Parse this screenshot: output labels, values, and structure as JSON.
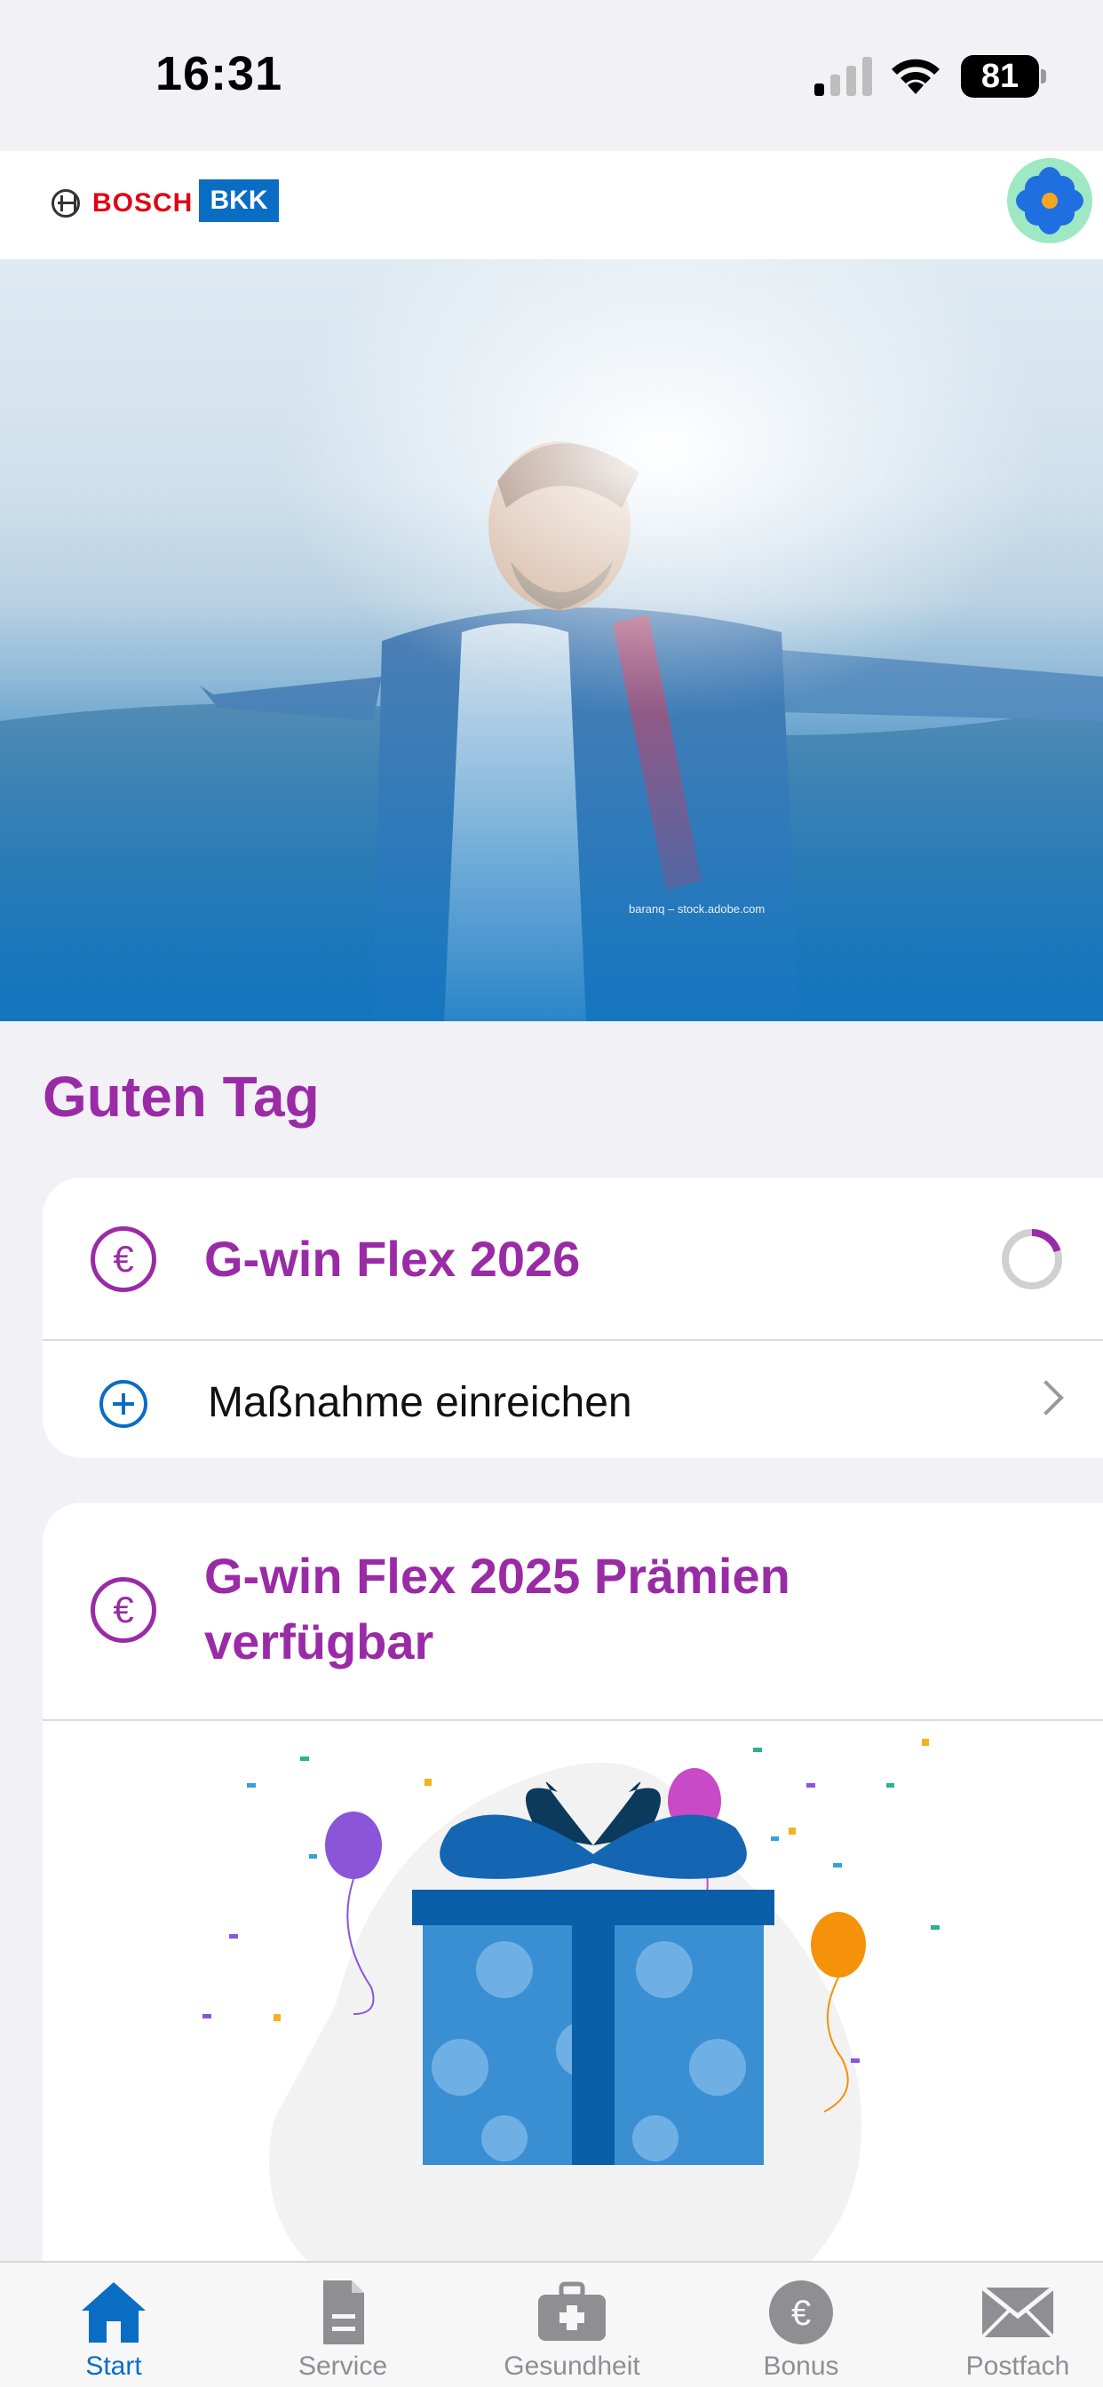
{
  "status_bar": {
    "time": "16:31",
    "battery_level": "81",
    "icons": [
      "signal-icon",
      "wifi-icon",
      "battery-icon"
    ]
  },
  "header": {
    "logo_text": "BOSCH",
    "badge_text": "BKK",
    "avatar_icon": "flower-avatar-icon"
  },
  "hero": {
    "image": "man-with-open-arms-photo",
    "credit": "baranq – stock.adobe.com"
  },
  "greeting": "Guten Tag",
  "card_flex_2026": {
    "icon": "euro-icon",
    "title": "G-win Flex 2026",
    "progress": 0.2,
    "action_icon": "plus-circle-icon",
    "action_label": "Maßnahme einreichen"
  },
  "card_flex_2025": {
    "icon": "euro-icon",
    "title_line1": "G-win Flex 2025 Prämien",
    "title_line2": "verfügbar",
    "illustration": "gift-box-with-balloons-illustration"
  },
  "tab_bar": {
    "tabs": [
      {
        "label": "Start",
        "icon": "home-icon",
        "active": true
      },
      {
        "label": "Service",
        "icon": "document-icon",
        "active": false
      },
      {
        "label": "Gesundheit",
        "icon": "medical-kit-icon",
        "active": false
      },
      {
        "label": "Bonus",
        "icon": "euro-coin-icon",
        "active": false
      },
      {
        "label": "Postfach",
        "icon": "mail-icon",
        "active": false
      }
    ]
  },
  "colors": {
    "accent_purple": "#9a2ba6",
    "brand_blue": "#0a6dc4",
    "bosch_red": "#e20015",
    "background": "#f2f1f6"
  }
}
